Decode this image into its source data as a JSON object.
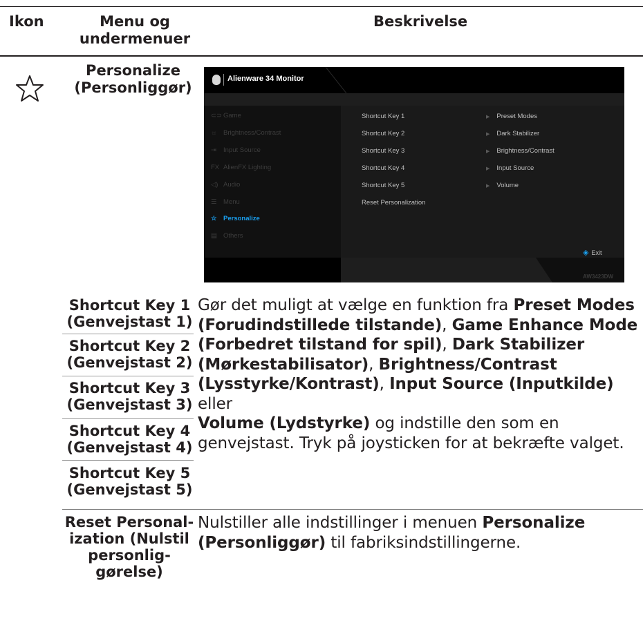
{
  "header": {
    "col1": "Ikon",
    "col2_line1": "Menu og",
    "col2_line2": "undermenuer",
    "col3": "Beskrivelse"
  },
  "personalize": {
    "icon": "star-icon",
    "label_line1": "Personalize",
    "label_line2": "(Personliggør)"
  },
  "osd": {
    "title": "Alienware 34 Monitor",
    "menu": [
      {
        "icon": "gamepad-icon",
        "label": "Game"
      },
      {
        "icon": "brightness-icon",
        "label": "Brightness/Contrast"
      },
      {
        "icon": "input-source-icon",
        "label": "Input Source"
      },
      {
        "icon": "fx-icon",
        "label": "AlienFX Lighting"
      },
      {
        "icon": "speaker-icon",
        "label": "Audio"
      },
      {
        "icon": "menu-icon",
        "label": "Menu"
      },
      {
        "icon": "star-icon",
        "label": "Personalize"
      },
      {
        "icon": "others-icon",
        "label": "Others"
      }
    ],
    "sub_items": [
      "Shortcut Key 1",
      "Shortcut Key 2",
      "Shortcut Key 3",
      "Shortcut Key 4",
      "Shortcut Key 5",
      "Reset Personalization"
    ],
    "values": [
      "Preset Modes",
      "Dark Stabilizer",
      "Brightness/Contrast",
      "Input Source",
      "Volume"
    ],
    "exit": "Exit",
    "model": "AW3423DW",
    "selected_color": "#1aa0f0"
  },
  "shortcuts": [
    {
      "line1": "Shortcut Key 1",
      "line2": "(Genvejstast 1)"
    },
    {
      "line1": "Shortcut Key 2",
      "line2": "(Genvejstast 2)"
    },
    {
      "line1": "Shortcut Key 3",
      "line2": "(Genvejstast 3)"
    },
    {
      "line1": "Shortcut Key 4",
      "line2": "(Genvejstast 4)"
    },
    {
      "line1": "Shortcut Key 5",
      "line2": "(Genvejstast 5)"
    }
  ],
  "shortcut_desc": {
    "l1a": "Gør det muligt at vælge en funktion fra ",
    "l1b": "Preset Modes",
    "l2a": "(Forudindstillede tilstande)",
    "l2b": ", ",
    "l2c": "Game Enhance Mode",
    "l3a": "(Forbedret tilstand for spil)",
    "l3b": ", ",
    "l3c": "Dark Stabilizer",
    "l4a": "(Mørkestabilisator)",
    "l4b": ", ",
    "l4c": "Brightness/Contrast",
    "l5a": "(Lysstyrke/Kontrast)",
    "l5b": ", ",
    "l5c": "Input Source (Inputkilde)",
    "l5d": " eller",
    "l6a": "Volume (Lydstyrke)",
    "l6b": " og indstille den som en",
    "l7": "genvejstast. Tryk på joysticken for at bekræfte valget."
  },
  "reset": {
    "line1": "Reset Personal-",
    "line2": "ization (Nulstil",
    "line3": "personlig-",
    "line4": "gørelse)",
    "desc_a": "Nulstiller alle indstillinger i menuen ",
    "desc_b": "Personalize",
    "desc_c": "(Personliggør)",
    "desc_d": " til fabriksindstillingerne."
  }
}
